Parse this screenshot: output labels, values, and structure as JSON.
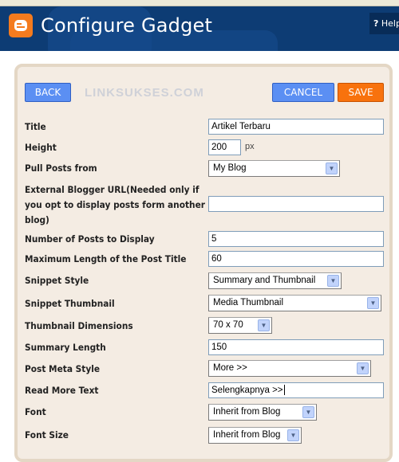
{
  "header": {
    "title": "Configure Gadget",
    "help_label": "Help",
    "help_icon": "?"
  },
  "toolbar": {
    "back_label": "BACK",
    "watermark": "LINKSUKSES.COM",
    "cancel_label": "CANCEL",
    "save_label": "SAVE"
  },
  "form": {
    "title": {
      "label": "Title",
      "value": "Artikel Terbaru"
    },
    "height": {
      "label": "Height",
      "value": "200",
      "unit": "px"
    },
    "pull_posts_from": {
      "label": "Pull Posts from",
      "value": "My Blog"
    },
    "external_url": {
      "label_line1": "External Blogger URL(Needed only if",
      "label_line2": "you opt to display posts form another",
      "label_line3": "blog)",
      "value": ""
    },
    "num_posts": {
      "label": "Number of Posts to Display",
      "value": "5"
    },
    "max_title_length": {
      "label": "Maximum Length of the Post Title",
      "value": "60"
    },
    "snippet_style": {
      "label": "Snippet Style",
      "value": "Summary and Thumbnail"
    },
    "snippet_thumbnail": {
      "label": "Snippet Thumbnail",
      "value": "Media Thumbnail"
    },
    "thumbnail_dimensions": {
      "label": "Thumbnail Dimensions",
      "value": "70 x 70"
    },
    "summary_length": {
      "label": "Summary Length",
      "value": "150"
    },
    "post_meta_style": {
      "label": "Post Meta Style",
      "value": "More >>"
    },
    "read_more_text": {
      "label": "Read More Text",
      "value": "Selengkapnya >>"
    },
    "font": {
      "label": "Font",
      "value": "Inherit from Blog"
    },
    "font_size": {
      "label": "Font Size",
      "value": "Inherit from Blog"
    }
  },
  "colors": {
    "header_bg": "#0d3c74",
    "panel_bg": "#f4ece3",
    "button_blue": "#5b8ff3",
    "button_orange": "#f8720d",
    "logo_orange": "#f47b1e"
  }
}
